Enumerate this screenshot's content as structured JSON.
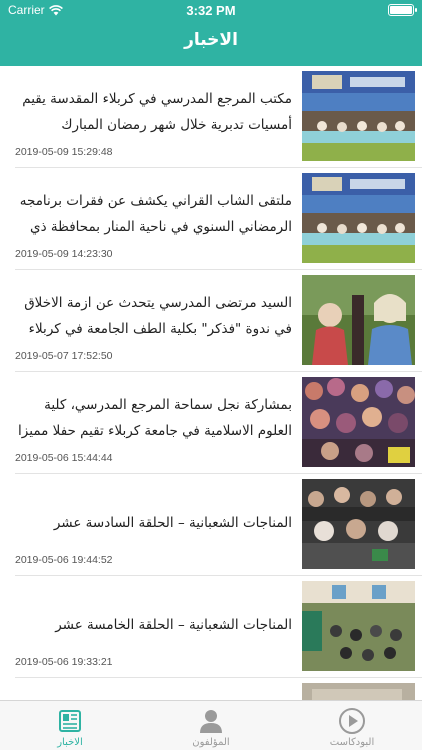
{
  "status_bar": {
    "carrier": "Carrier",
    "time": "3:32 PM"
  },
  "header": {
    "title": "الاخبار"
  },
  "news": [
    {
      "title": "مكتب المرجع المدرسي في كربلاء المقدسة يقيم أمسيات تدبرية خلال شهر رمضان المبارك",
      "date": "2019-05-09 15:29:48"
    },
    {
      "title": "ملتقى الشاب القراني يكشف عن فقرات برنامجه الرمضاني السنوي في ناحية المنار بمحافظة ذي قار",
      "date": "2019-05-09 14:23:30"
    },
    {
      "title": "السيد مرتضى المدرسي يتحدث عن ازمة الاخلاق في ندوة \"فذكر\" بكلية الطف الجامعة في كربلاء ال...",
      "date": "2019-05-07 17:52:50"
    },
    {
      "title": "بمشاركة نجل سماحة المرجع المدرسي، كلية العلوم الاسلامية في جامعة كربلاء تقيم حفلا مميزا لتخ...",
      "date": "2019-05-06 15:44:44"
    },
    {
      "title": "المناجات الشعبانية – الحلقة السادسة عشر",
      "date": "2019-05-06 19:44:52"
    },
    {
      "title": "المناجات الشعبانية – الحلقة الخامسة عشر",
      "date": "2019-05-06 19:33:21"
    },
    {
      "title": "",
      "date": ""
    }
  ],
  "tabs": [
    {
      "label": "الاخبار",
      "icon": "news-icon",
      "active": true
    },
    {
      "label": "المؤلفون",
      "icon": "person-icon",
      "active": false
    },
    {
      "label": "البودكاست",
      "icon": "play-icon",
      "active": false
    }
  ],
  "colors": {
    "accent": "#2fb3a3",
    "tab_inactive": "#9a9a9a"
  }
}
